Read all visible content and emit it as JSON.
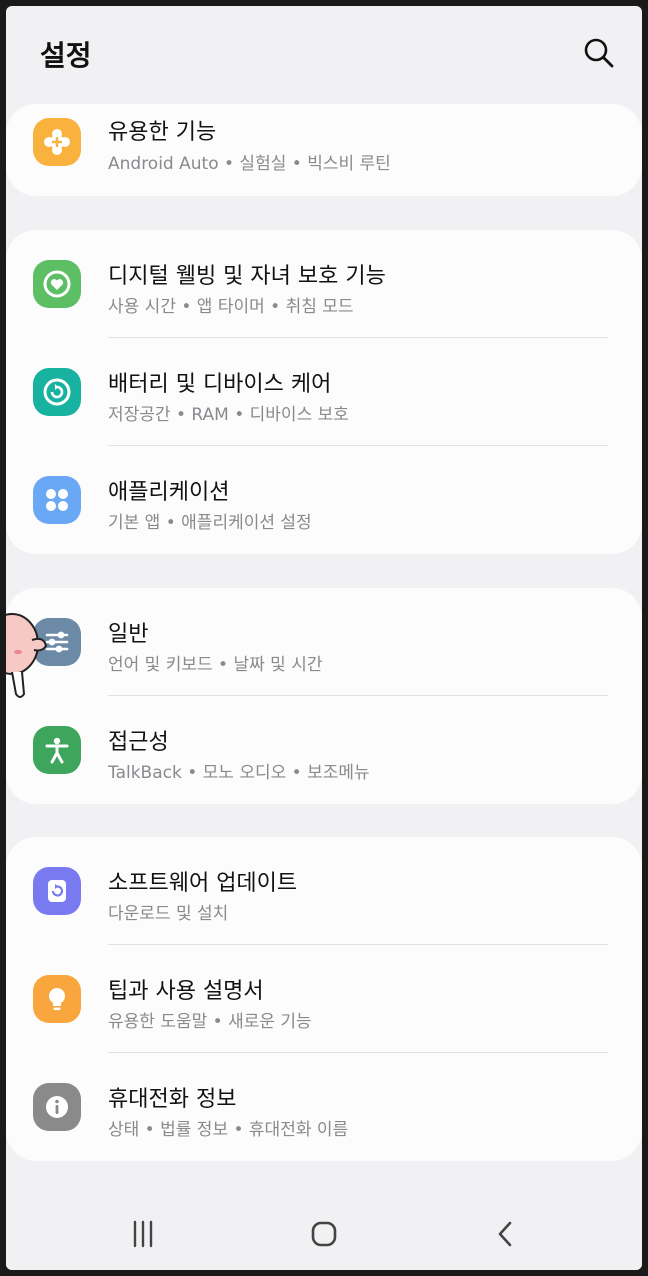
{
  "header": {
    "title": "설정",
    "search_icon": "search-icon"
  },
  "colors": {
    "background": "#f1f1f3",
    "card": "#fcfcfd",
    "title_text": "#121212",
    "subtitle_text": "#8a8a8e",
    "icon_useful": "#f8b23d",
    "icon_wellbeing": "#5cbf64",
    "icon_battery": "#17b3a0",
    "icon_apps": "#6aa7f5",
    "icon_general": "#6c8aa6",
    "icon_accessibility": "#3da55c",
    "icon_update": "#7a7af0",
    "icon_tips": "#f8a63d",
    "icon_about": "#8a8a8a"
  },
  "cards": [
    {
      "items": [
        {
          "title": "유용한 기능",
          "subtitle": "Android Auto  •  실험실  •  빅스비 루틴",
          "icon": "plus-gear-icon"
        }
      ]
    },
    {
      "items": [
        {
          "title": "디지털 웰빙 및 자녀 보호 기능",
          "subtitle": "사용 시간  •  앱 타이머  •  취침 모드",
          "icon": "wellbeing-heart-icon"
        },
        {
          "title": "배터리 및 디바이스 케어",
          "subtitle": "저장공간  •  RAM  •  디바이스 보호",
          "icon": "device-care-icon"
        },
        {
          "title": "애플리케이션",
          "subtitle": "기본 앱  •  애플리케이션 설정",
          "icon": "apps-grid-icon"
        }
      ]
    },
    {
      "items": [
        {
          "title": "일반",
          "subtitle": "언어 및 키보드  •  날짜 및 시간",
          "icon": "sliders-icon"
        },
        {
          "title": "접근성",
          "subtitle": "TalkBack  •  모노 오디오  •  보조메뉴",
          "icon": "accessibility-person-icon"
        }
      ]
    },
    {
      "items": [
        {
          "title": "소프트웨어 업데이트",
          "subtitle": "다운로드 및 설치",
          "icon": "software-update-icon"
        },
        {
          "title": "팁과 사용 설명서",
          "subtitle": "유용한 도움말  •  새로운 기능",
          "icon": "lightbulb-icon"
        },
        {
          "title": "휴대전화 정보",
          "subtitle": "상태  •  법률 정보  •  휴대전화 이름",
          "icon": "info-icon"
        }
      ]
    }
  ],
  "navbar": {
    "recents_icon": "recents-icon",
    "home_icon": "home-icon",
    "back_icon": "back-icon"
  }
}
